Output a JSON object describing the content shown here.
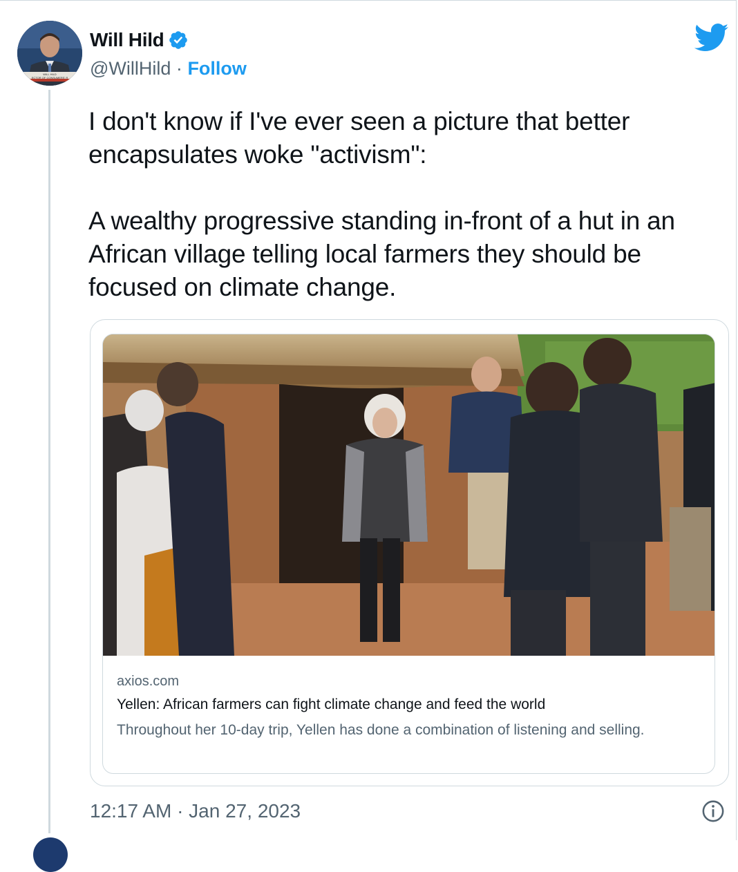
{
  "author": {
    "display_name": "Will Hild",
    "handle": "@WillHild",
    "separator": "·",
    "follow_label": "Follow",
    "verified": true,
    "avatar_caption_line1": "WILL HILD",
    "avatar_caption_line2": "ECTOR OF CONSUMERS' R"
  },
  "tweet": {
    "text": "I don't know if I've ever seen a picture that better encapsulates woke \"activism\":\n\nA wealthy progressive standing in-front of a hut in an African village telling local farmers they should be focused on climate change."
  },
  "card": {
    "domain": "axios.com",
    "title": "Yellen: African farmers can fight climate change and feed the world",
    "description": "Throughout her 10-day trip, Yellen has done a combination of listening and selling."
  },
  "footer": {
    "timestamp": "12:17 AM · Jan 27, 2023"
  },
  "icons": {
    "verified": "verified-badge-icon",
    "bird": "twitter-bird-icon",
    "info": "info-icon"
  },
  "colors": {
    "accent": "#1d9bf0",
    "secondary_text": "#536471",
    "border": "#cfd9de"
  }
}
